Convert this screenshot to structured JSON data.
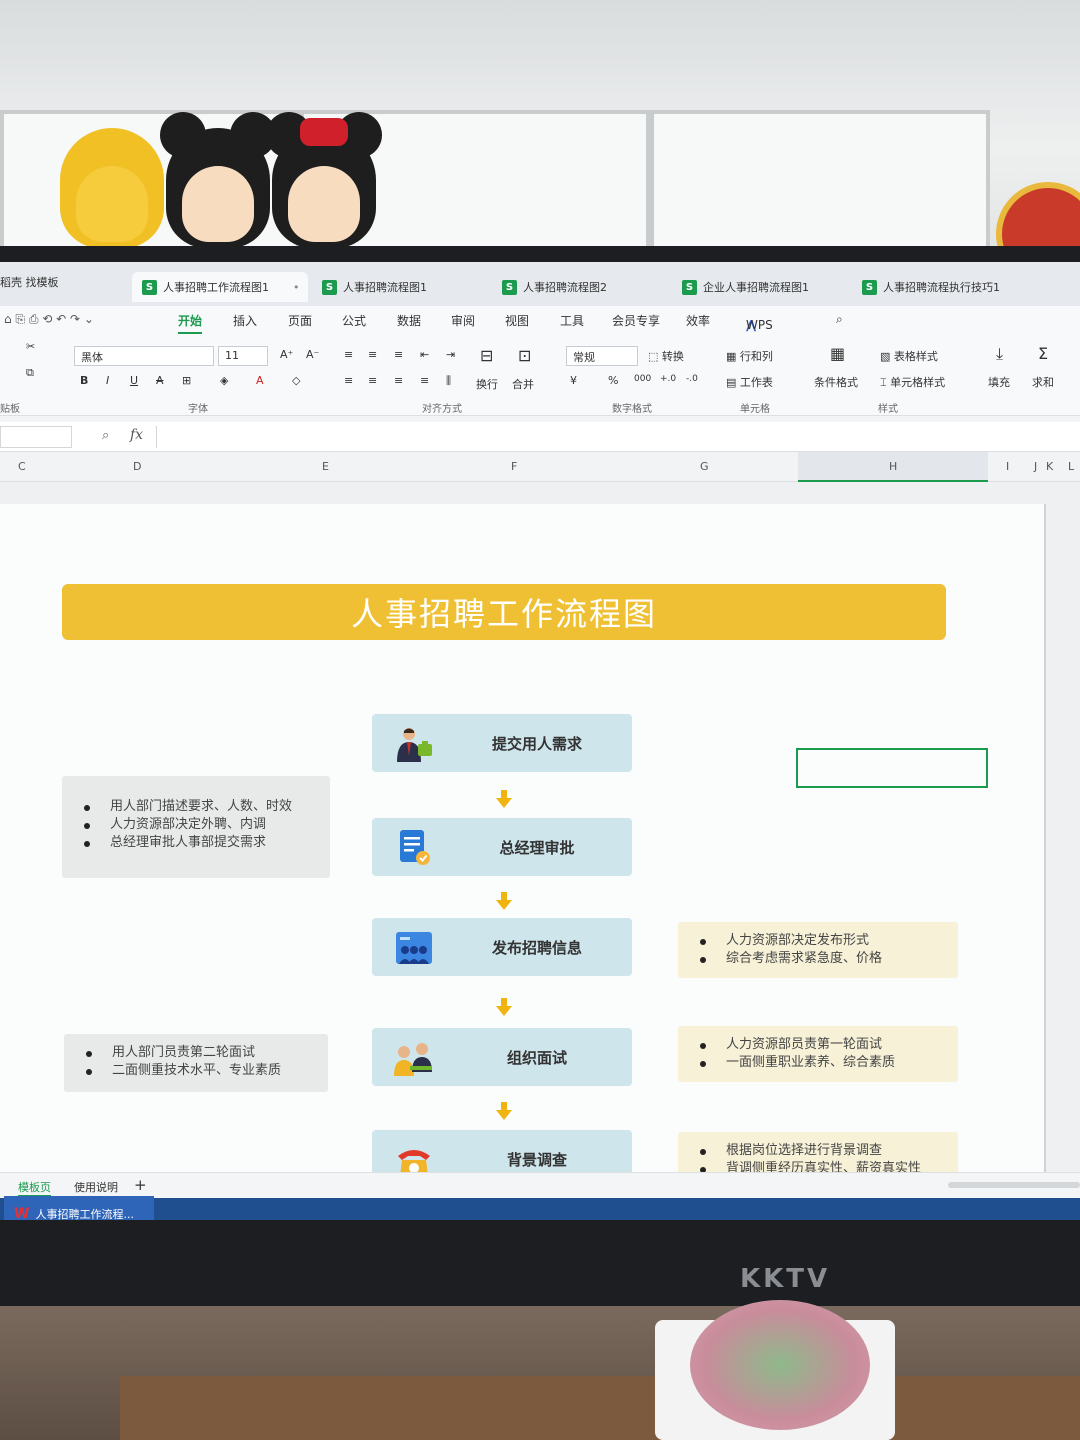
{
  "tabs": {
    "template": "稻壳 找模板",
    "items": [
      {
        "label": "人事招聘工作流程图1",
        "active": true
      },
      {
        "label": "人事招聘流程图1"
      },
      {
        "label": "人事招聘流程图2"
      },
      {
        "label": "企业人事招聘流程图1"
      },
      {
        "label": "人事招聘流程执行技巧1"
      }
    ]
  },
  "menu": [
    "开始",
    "插入",
    "页面",
    "公式",
    "数据",
    "审阅",
    "视图",
    "工具",
    "会员专享",
    "效率",
    "WPS AI"
  ],
  "ribbon": {
    "font_name": "黑体",
    "font_size": "11",
    "number_format": "常规",
    "convert": "转换",
    "wrap": "换行",
    "merge": "合并",
    "rows_cols": "行和列",
    "worksheet": "工作表",
    "cond_format": "条件格式",
    "table_style": "表格样式",
    "cell_style": "单元格样式",
    "fill": "填充",
    "sum": "求和",
    "groups": {
      "font": "字体",
      "align": "对齐方式",
      "number": "数字格式",
      "cell": "单元格",
      "style": "样式",
      "clipboard": "贴板"
    }
  },
  "formula": {
    "fx": "fx"
  },
  "columns": [
    "C",
    "D",
    "E",
    "F",
    "G",
    "H",
    "I",
    "J",
    "K",
    "L"
  ],
  "flow": {
    "title": "人事招聘工作流程图",
    "steps": [
      {
        "label": "提交用人需求",
        "icon": "manager-icon"
      },
      {
        "label": "总经理审批",
        "icon": "document-approval-icon"
      },
      {
        "label": "发布招聘信息",
        "icon": "team-board-icon"
      },
      {
        "label": "组织面试",
        "icon": "interview-icon"
      },
      {
        "label": "背景调查",
        "icon": "telephone-icon"
      }
    ],
    "notes": {
      "submit": [
        "用人部门描述要求、人数、时效",
        "人力资源部决定外聘、内调",
        "总经理审批人事部提交需求"
      ],
      "publish": [
        "人力资源部决定发布形式",
        "综合考虑需求紧急度、价格"
      ],
      "interview_left": [
        "用人部门员责第二轮面试",
        "二面侧重技术水平、专业素质"
      ],
      "interview_right": [
        "人力资源部员责第一轮面试",
        "一面侧重职业素养、综合素质"
      ],
      "background": [
        "根据岗位选择进行背景调查",
        "背调侧重经历真实性、薪资真实性"
      ]
    }
  },
  "sheet_tabs": [
    "模板页",
    "使用说明",
    "+"
  ],
  "taskbar": {
    "app_label": "人事招聘工作流程..."
  },
  "monitor_brand": "KKTV",
  "colors": {
    "accent": "#1c9a4d",
    "title_bar": "#f0c034",
    "step_fill": "#cfe5ec",
    "arrow": "#f0b410"
  }
}
